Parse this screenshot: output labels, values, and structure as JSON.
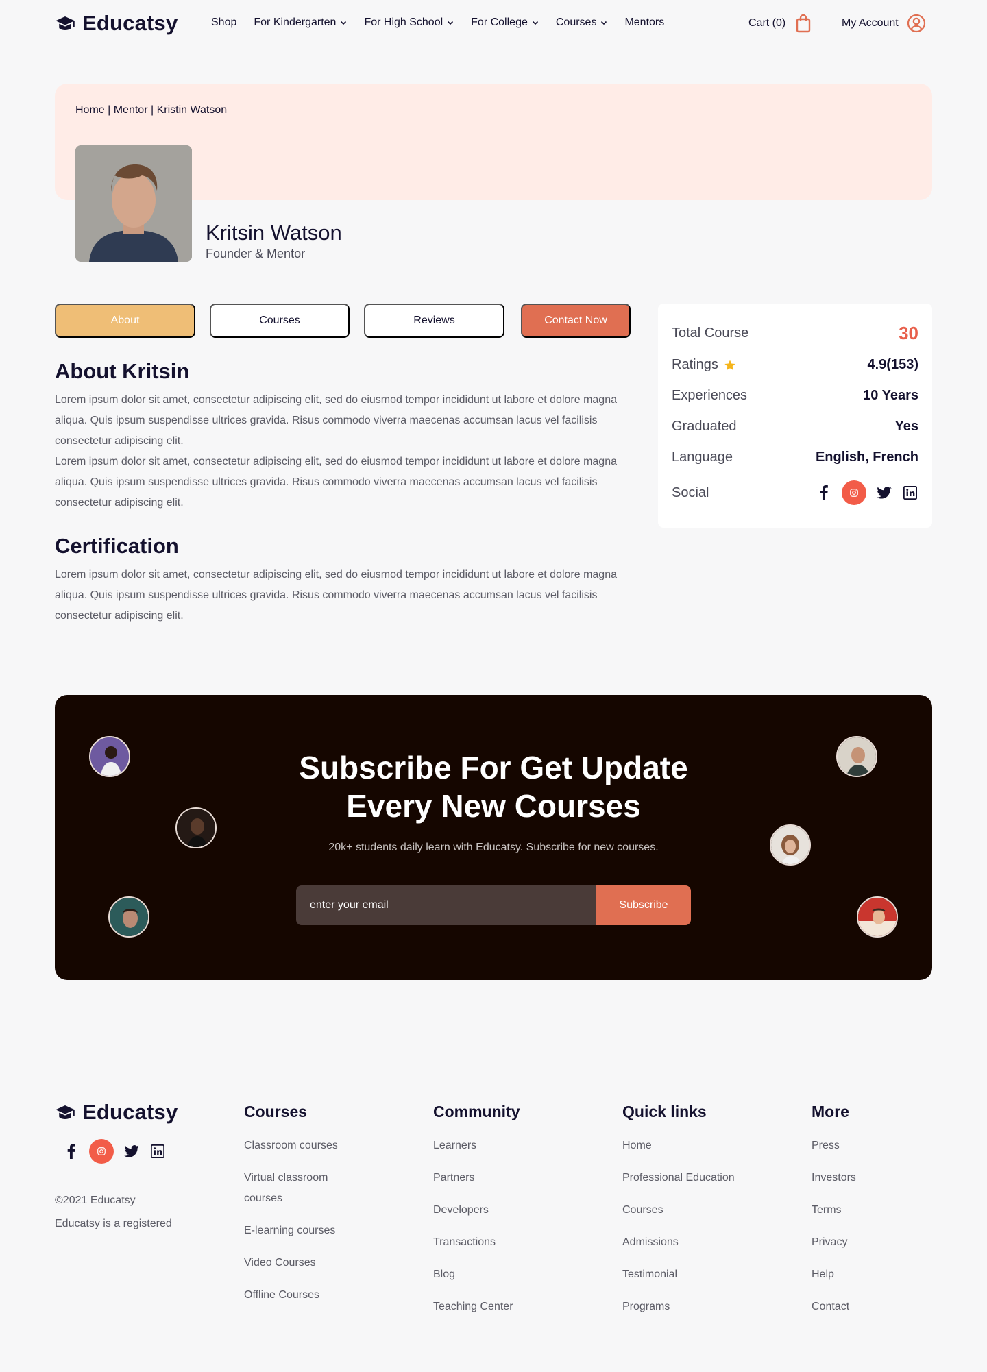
{
  "brand": {
    "name": "Educatsy"
  },
  "nav": {
    "items": [
      {
        "label": "Shop",
        "dropdown": false
      },
      {
        "label": "For Kindergarten",
        "dropdown": true
      },
      {
        "label": "For High School",
        "dropdown": true
      },
      {
        "label": "For College",
        "dropdown": true
      },
      {
        "label": "Courses",
        "dropdown": true
      },
      {
        "label": "Mentors",
        "dropdown": false
      }
    ],
    "cart_label": "Cart (0)",
    "account_label": "My Account"
  },
  "hero": {
    "breadcrumb": "Home | Mentor | Kristin Watson",
    "mentor_name": "Kritsin Watson",
    "mentor_role": "Founder & Mentor"
  },
  "tabs": {
    "about": "About",
    "courses": "Courses",
    "reviews": "Reviews",
    "contact": "Contact Now"
  },
  "about": {
    "title": "About Kritsin",
    "paragraphs": [
      "Lorem ipsum dolor sit amet, consectetur adipiscing elit, sed do eiusmod tempor incididunt ut labore et dolore magna aliqua. Quis ipsum suspendisse ultrices gravida. Risus commodo viverra maecenas accumsan lacus vel facilisis consectetur adipiscing elit.",
      "Lorem ipsum dolor sit amet, consectetur adipiscing elit, sed do eiusmod tempor incididunt ut labore et dolore magna aliqua. Quis ipsum suspendisse ultrices gravida. Risus commodo viverra maecenas accumsan lacus vel facilisis consectetur adipiscing elit."
    ]
  },
  "certification": {
    "title": "Certification",
    "paragraph": "Lorem ipsum dolor sit amet, consectetur adipiscing elit, sed do eiusmod tempor incididunt ut labore et dolore magna aliqua. Quis ipsum suspendisse ultrices gravida. Risus commodo viverra maecenas accumsan lacus vel facilisis consectetur adipiscing elit."
  },
  "stats": {
    "total_course_label": "Total Course",
    "total_course_value": "30",
    "ratings_label": "Ratings",
    "ratings_value": "4.9(153)",
    "experiences_label": "Experiences",
    "experiences_value": "10 Years",
    "graduated_label": "Graduated",
    "graduated_value": "Yes",
    "language_label": "Language",
    "language_value": "English, French",
    "social_label": "Social"
  },
  "subscribe": {
    "title_line1": "Subscribe For Get Update",
    "title_line2": "Every New Courses",
    "text": "20k+ students daily learn with Educatsy. Subscribe for new courses.",
    "input_placeholder": "enter your email",
    "button_label": "Subscribe"
  },
  "footer": {
    "copyright": "©2021 Educatsy",
    "registered": "Educatsy is a registered",
    "columns": [
      {
        "title": "Courses",
        "links": [
          "Classroom courses",
          "Virtual classroom courses",
          "E-learning courses",
          "Video Courses",
          "Offline Courses"
        ]
      },
      {
        "title": "Community",
        "links": [
          "Learners",
          "Partners",
          "Developers",
          "Transactions",
          "Blog",
          "Teaching Center"
        ]
      },
      {
        "title": "Quick links",
        "links": [
          "Home",
          "Professional Education",
          "Courses",
          "Admissions",
          "Testimonial",
          "Programs"
        ]
      },
      {
        "title": "More",
        "links": [
          "Press",
          "Investors",
          "Terms",
          "Privacy",
          "Help",
          "Contact"
        ]
      }
    ]
  },
  "colors": {
    "accent": "#e06f52",
    "accent_light": "#efbe76",
    "hero_bg": "#ffece7",
    "dark_bg": "#150600",
    "text_dark": "#14112e",
    "star": "#f5b51b"
  },
  "icons": [
    "graduation-cap-icon",
    "chevron-down-icon",
    "shopping-bag-icon",
    "user-circle-icon",
    "star-icon",
    "facebook-icon",
    "instagram-icon",
    "twitter-icon",
    "linkedin-icon"
  ]
}
